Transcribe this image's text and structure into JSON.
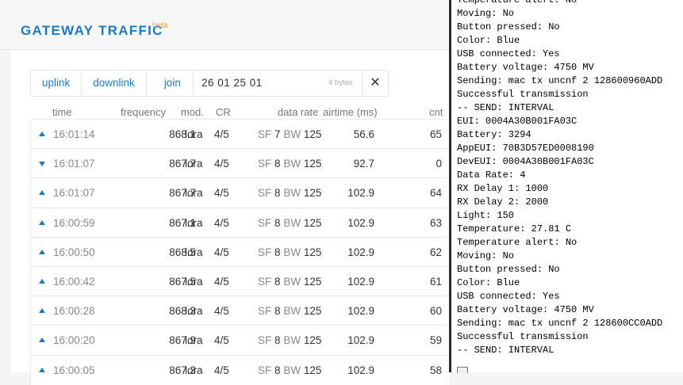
{
  "header": {
    "title": "GATEWAY TRAFFIC",
    "badge": "beta"
  },
  "filters": [
    "uplink",
    "downlink",
    "join"
  ],
  "payload": {
    "value": "26 01 25 01",
    "bytes": "4 bytes",
    "clear": "✕"
  },
  "columns": {
    "time": "time",
    "frequency": "frequency",
    "mod": "mod.",
    "cr": "CR",
    "data_rate": "data rate",
    "airtime": "airtime (ms)",
    "cnt": "cnt"
  },
  "rows": [
    {
      "dir": "up",
      "time": "16:01:14",
      "freq": "868.1",
      "mod": "lora",
      "cr": "4/5",
      "sf_label": "SF",
      "sf": "7",
      "bw_label": "BW",
      "bw": "125",
      "airtime": "56.6",
      "cnt": "65"
    },
    {
      "dir": "down",
      "time": "16:01:07",
      "freq": "867.7",
      "mod": "lora",
      "cr": "4/5",
      "sf_label": "SF",
      "sf": "8",
      "bw_label": "BW",
      "bw": "125",
      "airtime": "92.7",
      "cnt": "0"
    },
    {
      "dir": "up",
      "time": "16:01:07",
      "freq": "867.7",
      "mod": "lora",
      "cr": "4/5",
      "sf_label": "SF",
      "sf": "8",
      "bw_label": "BW",
      "bw": "125",
      "airtime": "102.9",
      "cnt": "64"
    },
    {
      "dir": "up",
      "time": "16:00:59",
      "freq": "867.1",
      "mod": "lora",
      "cr": "4/5",
      "sf_label": "SF",
      "sf": "8",
      "bw_label": "BW",
      "bw": "125",
      "airtime": "102.9",
      "cnt": "63"
    },
    {
      "dir": "up",
      "time": "16:00:50",
      "freq": "868.5",
      "mod": "lora",
      "cr": "4/5",
      "sf_label": "SF",
      "sf": "8",
      "bw_label": "BW",
      "bw": "125",
      "airtime": "102.9",
      "cnt": "62"
    },
    {
      "dir": "up",
      "time": "16:00:42",
      "freq": "867.5",
      "mod": "lora",
      "cr": "4/5",
      "sf_label": "SF",
      "sf": "8",
      "bw_label": "BW",
      "bw": "125",
      "airtime": "102.9",
      "cnt": "61"
    },
    {
      "dir": "up",
      "time": "16:00:28",
      "freq": "868.3",
      "mod": "lora",
      "cr": "4/5",
      "sf_label": "SF",
      "sf": "8",
      "bw_label": "BW",
      "bw": "125",
      "airtime": "102.9",
      "cnt": "60"
    },
    {
      "dir": "up",
      "time": "16:00:20",
      "freq": "867.9",
      "mod": "lora",
      "cr": "4/5",
      "sf_label": "SF",
      "sf": "8",
      "bw_label": "BW",
      "bw": "125",
      "airtime": "102.9",
      "cnt": "59"
    },
    {
      "dir": "up",
      "time": "16:00:05",
      "freq": "867.3",
      "mod": "lora",
      "cr": "4/5",
      "sf_label": "SF",
      "sf": "8",
      "bw_label": "BW",
      "bw": "125",
      "airtime": "102.9",
      "cnt": "58"
    }
  ],
  "terminal_lines": [
    "Temperature alert: No",
    "Moving: No",
    "Button pressed: No",
    "Color: Blue",
    "USB connected: Yes",
    "Battery voltage: 4750 MV",
    "Sending: mac tx uncnf 2 128600960ADD",
    "Successful transmission",
    "-- SEND: INTERVAL",
    "EUI: 0004A30B001FA03C",
    "Battery: 3294",
    "AppEUI: 70B3D57ED0008190",
    "DevEUI: 0004A30B001FA03C",
    "Data Rate: 4",
    "RX Delay 1: 1000",
    "RX Delay 2: 2000",
    "Light: 150",
    "Temperature: 27.81 C",
    "Temperature alert: No",
    "Moving: No",
    "Button pressed: No",
    "Color: Blue",
    "USB connected: Yes",
    "Battery voltage: 4750 MV",
    "Sending: mac tx uncnf 2 128600CC0ADD",
    "Successful transmission",
    "-- SEND: INTERVAL"
  ]
}
